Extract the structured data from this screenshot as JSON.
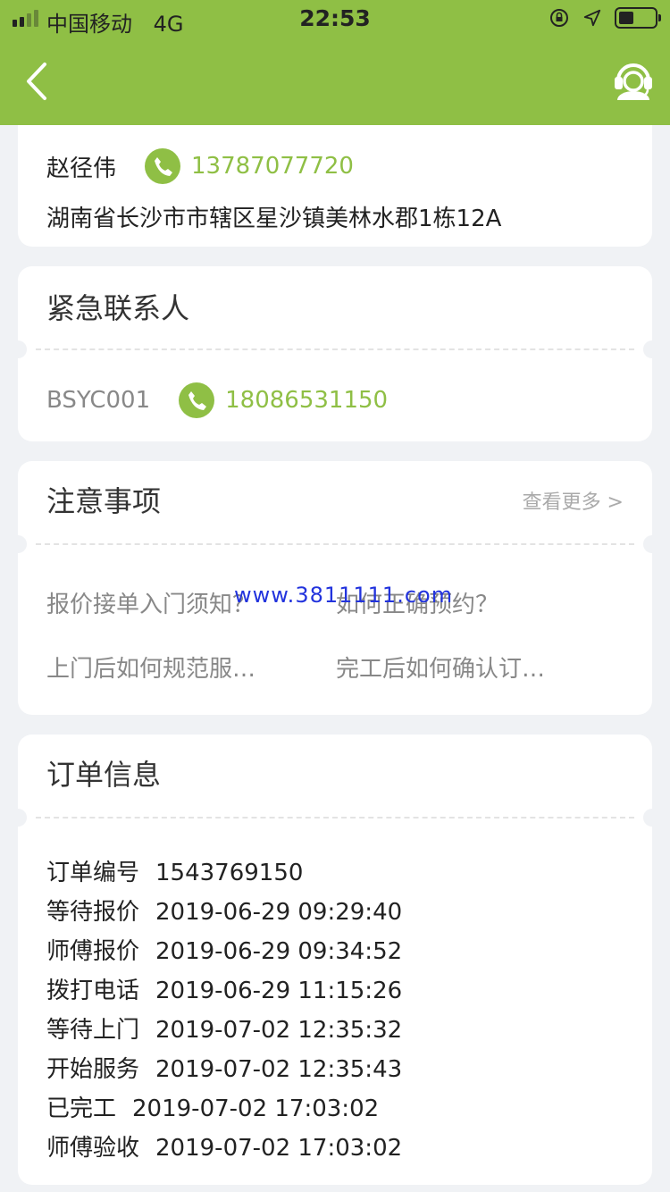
{
  "status_bar": {
    "carrier": "中国移动",
    "network": "4G",
    "time": "22:53"
  },
  "header": {
    "back_icon": "chevron-left-icon",
    "service_icon": "customer-service-icon",
    "color": "#8fbf45"
  },
  "customer": {
    "name": "赵径伟",
    "phone": "13787077720",
    "address": "湖南省长沙市市辖区星沙镇美林水郡1栋12A"
  },
  "emergency": {
    "title": "紧急联系人",
    "contact_name": "BSYC001",
    "phone": "18086531150"
  },
  "notes": {
    "title": "注意事项",
    "more_label": "查看更多 >",
    "links": [
      "报价接单入门须知？",
      "如何正确预约？",
      "上门后如何规范服…",
      "完工后如何确认订…"
    ]
  },
  "watermark": "www.3811111.com",
  "order": {
    "title": "订单信息",
    "rows": [
      {
        "label": "订单编号",
        "value": "1543769150"
      },
      {
        "label": "等待报价",
        "value": "2019-06-29 09:29:40"
      },
      {
        "label": "师傅报价",
        "value": "2019-06-29 09:34:52"
      },
      {
        "label": "拨打电话",
        "value": "2019-06-29 11:15:26"
      },
      {
        "label": "等待上门",
        "value": "2019-07-02 12:35:32"
      },
      {
        "label": "开始服务",
        "value": "2019-07-02 12:35:43"
      },
      {
        "label": "已完工",
        "value": "2019-07-02 17:03:02"
      },
      {
        "label": "师傅验收",
        "value": "2019-07-02 17:03:02"
      }
    ]
  }
}
